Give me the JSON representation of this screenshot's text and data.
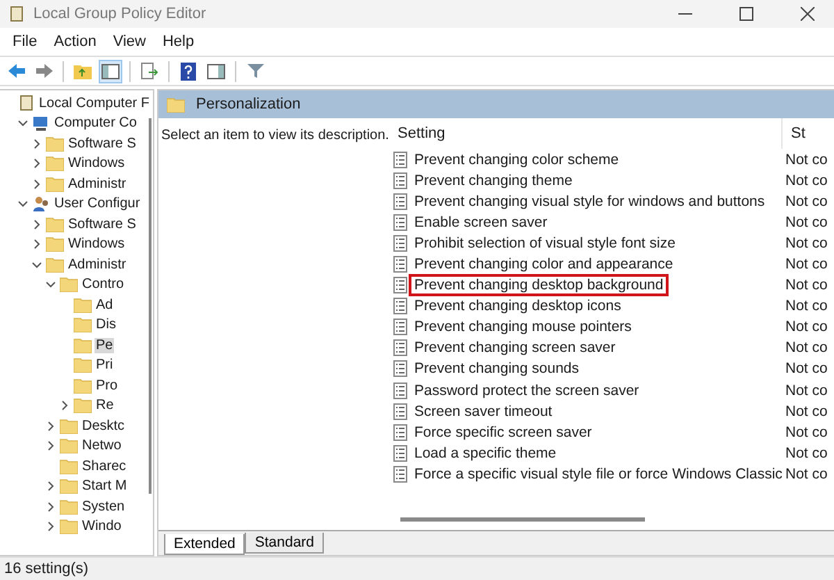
{
  "window": {
    "title": "Local Group Policy Editor"
  },
  "menu": [
    "File",
    "Action",
    "View",
    "Help"
  ],
  "toolbar": [
    {
      "kind": "back",
      "pressed": false
    },
    {
      "kind": "forward",
      "pressed": false
    },
    {
      "kind": "sep"
    },
    {
      "kind": "up",
      "pressed": false
    },
    {
      "kind": "tree",
      "pressed": true
    },
    {
      "kind": "sep"
    },
    {
      "kind": "export",
      "pressed": false
    },
    {
      "kind": "sep"
    },
    {
      "kind": "help",
      "pressed": false
    },
    {
      "kind": "pane",
      "pressed": false
    },
    {
      "kind": "sep"
    },
    {
      "kind": "filter",
      "pressed": false
    }
  ],
  "tree": [
    {
      "label": "Local Computer F",
      "kind": "root",
      "selected": false,
      "children": [
        {
          "label": "Computer Co",
          "kind": "computer",
          "expanded": true,
          "selected": false,
          "children": [
            {
              "label": "Software S",
              "kind": "folder",
              "expanded": false,
              "selected": false
            },
            {
              "label": "Windows",
              "kind": "folder",
              "expanded": false,
              "selected": false
            },
            {
              "label": "Administr",
              "kind": "folder",
              "expanded": false,
              "selected": false
            }
          ]
        },
        {
          "label": "User Configur",
          "kind": "user",
          "expanded": true,
          "selected": false,
          "children": [
            {
              "label": "Software S",
              "kind": "folder",
              "expanded": false,
              "selected": false
            },
            {
              "label": "Windows",
              "kind": "folder",
              "expanded": false,
              "selected": false
            },
            {
              "label": "Administr",
              "kind": "folder",
              "expanded": true,
              "selected": false,
              "children": [
                {
                  "label": "Contro",
                  "kind": "folder",
                  "expanded": true,
                  "selected": false,
                  "children": [
                    {
                      "label": "Ad",
                      "kind": "folder",
                      "selected": false
                    },
                    {
                      "label": "Dis",
                      "kind": "folder",
                      "selected": false
                    },
                    {
                      "label": "Pe",
                      "kind": "folder",
                      "selected": true
                    },
                    {
                      "label": "Pri",
                      "kind": "folder",
                      "selected": false
                    },
                    {
                      "label": "Pro",
                      "kind": "folder",
                      "selected": false
                    },
                    {
                      "label": "Re",
                      "kind": "folder",
                      "expanded": false,
                      "selected": false
                    }
                  ]
                },
                {
                  "label": "Desktc",
                  "kind": "folder",
                  "expanded": false,
                  "selected": false
                },
                {
                  "label": "Netwo",
                  "kind": "folder",
                  "expanded": false,
                  "selected": false
                },
                {
                  "label": "Sharec",
                  "kind": "folder",
                  "selected": false
                },
                {
                  "label": "Start M",
                  "kind": "folder",
                  "expanded": false,
                  "selected": false
                },
                {
                  "label": "Systen",
                  "kind": "folder",
                  "expanded": false,
                  "selected": false
                },
                {
                  "label": "Windo",
                  "kind": "folder",
                  "expanded": false,
                  "selected": false
                }
              ]
            }
          ]
        }
      ]
    }
  ],
  "header": {
    "title": "Personalization"
  },
  "description": "Select an item to view its description.",
  "columns": [
    "Setting",
    "St"
  ],
  "rows": [
    {
      "setting": "Prevent changing color scheme",
      "state": "Not co",
      "highlighted": false
    },
    {
      "setting": "Prevent changing theme",
      "state": "Not co",
      "highlighted": false
    },
    {
      "setting": "Prevent changing visual style for windows and buttons",
      "state": "Not co",
      "highlighted": false
    },
    {
      "setting": "Enable screen saver",
      "state": "Not co",
      "highlighted": false
    },
    {
      "setting": "Prohibit selection of visual style font size",
      "state": "Not co",
      "highlighted": false
    },
    {
      "setting": "Prevent changing color and appearance",
      "state": "Not co",
      "highlighted": false
    },
    {
      "setting": "Prevent changing desktop background",
      "state": "Not co",
      "highlighted": true
    },
    {
      "setting": "Prevent changing desktop icons",
      "state": "Not co",
      "highlighted": false
    },
    {
      "setting": "Prevent changing mouse pointers",
      "state": "Not co",
      "highlighted": false
    },
    {
      "setting": "Prevent changing screen saver",
      "state": "Not co",
      "highlighted": false
    },
    {
      "setting": "Prevent changing sounds",
      "state": "Not co",
      "highlighted": false
    },
    {
      "setting": "Password protect the screen saver",
      "state": "Not co",
      "highlighted": false
    },
    {
      "setting": "Screen saver timeout",
      "state": "Not co",
      "highlighted": false
    },
    {
      "setting": "Force specific screen saver",
      "state": "Not co",
      "highlighted": false
    },
    {
      "setting": "Load a specific theme",
      "state": "Not co",
      "highlighted": false
    },
    {
      "setting": "Force a specific visual style file or force Windows Classic",
      "state": "Not co",
      "highlighted": false
    }
  ],
  "tabs": [
    {
      "label": "Extended",
      "selected": true
    },
    {
      "label": "Standard",
      "selected": false
    }
  ],
  "status_bar": "16 setting(s)"
}
